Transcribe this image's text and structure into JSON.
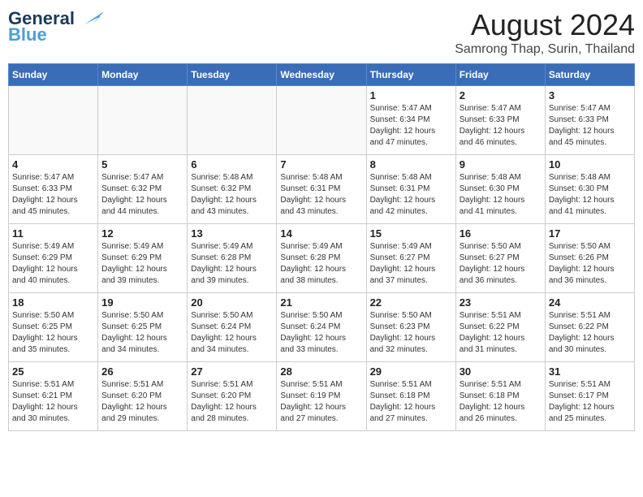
{
  "header": {
    "logo_general": "General",
    "logo_blue": "Blue",
    "main_title": "August 2024",
    "subtitle": "Samrong Thap, Surin, Thailand"
  },
  "calendar": {
    "days_of_week": [
      "Sunday",
      "Monday",
      "Tuesday",
      "Wednesday",
      "Thursday",
      "Friday",
      "Saturday"
    ],
    "weeks": [
      [
        {
          "day": "",
          "info": ""
        },
        {
          "day": "",
          "info": ""
        },
        {
          "day": "",
          "info": ""
        },
        {
          "day": "",
          "info": ""
        },
        {
          "day": "1",
          "info": "Sunrise: 5:47 AM\nSunset: 6:34 PM\nDaylight: 12 hours\nand 47 minutes."
        },
        {
          "day": "2",
          "info": "Sunrise: 5:47 AM\nSunset: 6:33 PM\nDaylight: 12 hours\nand 46 minutes."
        },
        {
          "day": "3",
          "info": "Sunrise: 5:47 AM\nSunset: 6:33 PM\nDaylight: 12 hours\nand 45 minutes."
        }
      ],
      [
        {
          "day": "4",
          "info": "Sunrise: 5:47 AM\nSunset: 6:33 PM\nDaylight: 12 hours\nand 45 minutes."
        },
        {
          "day": "5",
          "info": "Sunrise: 5:47 AM\nSunset: 6:32 PM\nDaylight: 12 hours\nand 44 minutes."
        },
        {
          "day": "6",
          "info": "Sunrise: 5:48 AM\nSunset: 6:32 PM\nDaylight: 12 hours\nand 43 minutes."
        },
        {
          "day": "7",
          "info": "Sunrise: 5:48 AM\nSunset: 6:31 PM\nDaylight: 12 hours\nand 43 minutes."
        },
        {
          "day": "8",
          "info": "Sunrise: 5:48 AM\nSunset: 6:31 PM\nDaylight: 12 hours\nand 42 minutes."
        },
        {
          "day": "9",
          "info": "Sunrise: 5:48 AM\nSunset: 6:30 PM\nDaylight: 12 hours\nand 41 minutes."
        },
        {
          "day": "10",
          "info": "Sunrise: 5:48 AM\nSunset: 6:30 PM\nDaylight: 12 hours\nand 41 minutes."
        }
      ],
      [
        {
          "day": "11",
          "info": "Sunrise: 5:49 AM\nSunset: 6:29 PM\nDaylight: 12 hours\nand 40 minutes."
        },
        {
          "day": "12",
          "info": "Sunrise: 5:49 AM\nSunset: 6:29 PM\nDaylight: 12 hours\nand 39 minutes."
        },
        {
          "day": "13",
          "info": "Sunrise: 5:49 AM\nSunset: 6:28 PM\nDaylight: 12 hours\nand 39 minutes."
        },
        {
          "day": "14",
          "info": "Sunrise: 5:49 AM\nSunset: 6:28 PM\nDaylight: 12 hours\nand 38 minutes."
        },
        {
          "day": "15",
          "info": "Sunrise: 5:49 AM\nSunset: 6:27 PM\nDaylight: 12 hours\nand 37 minutes."
        },
        {
          "day": "16",
          "info": "Sunrise: 5:50 AM\nSunset: 6:27 PM\nDaylight: 12 hours\nand 36 minutes."
        },
        {
          "day": "17",
          "info": "Sunrise: 5:50 AM\nSunset: 6:26 PM\nDaylight: 12 hours\nand 36 minutes."
        }
      ],
      [
        {
          "day": "18",
          "info": "Sunrise: 5:50 AM\nSunset: 6:25 PM\nDaylight: 12 hours\nand 35 minutes."
        },
        {
          "day": "19",
          "info": "Sunrise: 5:50 AM\nSunset: 6:25 PM\nDaylight: 12 hours\nand 34 minutes."
        },
        {
          "day": "20",
          "info": "Sunrise: 5:50 AM\nSunset: 6:24 PM\nDaylight: 12 hours\nand 34 minutes."
        },
        {
          "day": "21",
          "info": "Sunrise: 5:50 AM\nSunset: 6:24 PM\nDaylight: 12 hours\nand 33 minutes."
        },
        {
          "day": "22",
          "info": "Sunrise: 5:50 AM\nSunset: 6:23 PM\nDaylight: 12 hours\nand 32 minutes."
        },
        {
          "day": "23",
          "info": "Sunrise: 5:51 AM\nSunset: 6:22 PM\nDaylight: 12 hours\nand 31 minutes."
        },
        {
          "day": "24",
          "info": "Sunrise: 5:51 AM\nSunset: 6:22 PM\nDaylight: 12 hours\nand 30 minutes."
        }
      ],
      [
        {
          "day": "25",
          "info": "Sunrise: 5:51 AM\nSunset: 6:21 PM\nDaylight: 12 hours\nand 30 minutes."
        },
        {
          "day": "26",
          "info": "Sunrise: 5:51 AM\nSunset: 6:20 PM\nDaylight: 12 hours\nand 29 minutes."
        },
        {
          "day": "27",
          "info": "Sunrise: 5:51 AM\nSunset: 6:20 PM\nDaylight: 12 hours\nand 28 minutes."
        },
        {
          "day": "28",
          "info": "Sunrise: 5:51 AM\nSunset: 6:19 PM\nDaylight: 12 hours\nand 27 minutes."
        },
        {
          "day": "29",
          "info": "Sunrise: 5:51 AM\nSunset: 6:18 PM\nDaylight: 12 hours\nand 27 minutes."
        },
        {
          "day": "30",
          "info": "Sunrise: 5:51 AM\nSunset: 6:18 PM\nDaylight: 12 hours\nand 26 minutes."
        },
        {
          "day": "31",
          "info": "Sunrise: 5:51 AM\nSunset: 6:17 PM\nDaylight: 12 hours\nand 25 minutes."
        }
      ]
    ]
  }
}
